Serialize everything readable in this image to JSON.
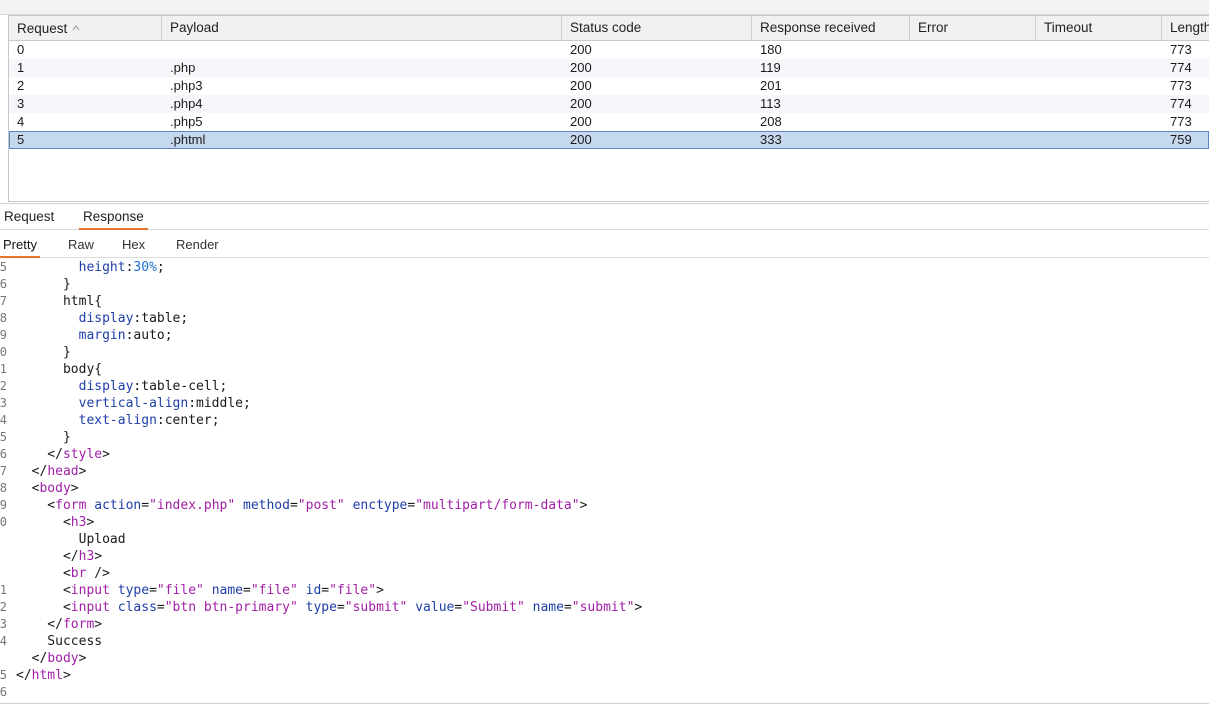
{
  "table": {
    "columns": [
      "Request",
      "Payload",
      "Status code",
      "Response received",
      "Error",
      "Timeout",
      "Length"
    ],
    "sorted_column": "Request",
    "rows": [
      {
        "request": "0",
        "payload": "",
        "status": "200",
        "received": "180",
        "error": "",
        "timeout": "",
        "length": "773"
      },
      {
        "request": "1",
        "payload": ".php",
        "status": "200",
        "received": "119",
        "error": "",
        "timeout": "",
        "length": "774"
      },
      {
        "request": "2",
        "payload": ".php3",
        "status": "200",
        "received": "201",
        "error": "",
        "timeout": "",
        "length": "773"
      },
      {
        "request": "3",
        "payload": ".php4",
        "status": "200",
        "received": "113",
        "error": "",
        "timeout": "",
        "length": "774"
      },
      {
        "request": "4",
        "payload": ".php5",
        "status": "200",
        "received": "208",
        "error": "",
        "timeout": "",
        "length": "773"
      },
      {
        "request": "5",
        "payload": ".phtml",
        "status": "200",
        "received": "333",
        "error": "",
        "timeout": "",
        "length": "759"
      }
    ],
    "selected_row": 5
  },
  "message_tabs": {
    "request": "Request",
    "response": "Response",
    "active": "Response"
  },
  "view_tabs": {
    "pretty": "Pretty",
    "raw": "Raw",
    "hex": "Hex",
    "render": "Render",
    "active": "Pretty"
  },
  "editor": {
    "lines": [
      {
        "n": "5",
        "text": "        height:30%;"
      },
      {
        "n": "6",
        "text": "      }"
      },
      {
        "n": "7",
        "text": "      html{"
      },
      {
        "n": "8",
        "text": "        display:table;"
      },
      {
        "n": "9",
        "text": "        margin:auto;"
      },
      {
        "n": "0",
        "text": "      }"
      },
      {
        "n": "1",
        "text": "      body{"
      },
      {
        "n": "2",
        "text": "        display:table-cell;"
      },
      {
        "n": "3",
        "text": "        vertical-align:middle;"
      },
      {
        "n": "4",
        "text": "        text-align:center;"
      },
      {
        "n": "5",
        "text": "      }"
      },
      {
        "n": "6",
        "text": "    </style>"
      },
      {
        "n": "7",
        "text": "  </head>"
      },
      {
        "n": "8",
        "text": "  <body>"
      },
      {
        "n": "9",
        "text": "    <form action=\"index.php\" method=\"post\" enctype=\"multipart/form-data\">"
      },
      {
        "n": "0",
        "text": "      <h3>"
      },
      {
        "n": "",
        "text": "        Upload"
      },
      {
        "n": "",
        "text": "      </h3>"
      },
      {
        "n": "",
        "text": "      <br />"
      },
      {
        "n": "1",
        "text": "      <input type=\"file\" name=\"file\" id=\"file\">"
      },
      {
        "n": "2",
        "text": "      <input class=\"btn btn-primary\" type=\"submit\" value=\"Submit\" name=\"submit\">"
      },
      {
        "n": "3",
        "text": "    </form>"
      },
      {
        "n": "4",
        "text": "    Success"
      },
      {
        "n": "",
        "text": "  </body>"
      },
      {
        "n": "5",
        "text": "</html>"
      },
      {
        "n": "6",
        "text": ""
      }
    ]
  },
  "colors": {
    "accent": "#e8712d",
    "selection": "#c6d8ee",
    "tag": "#a21fa7",
    "attr": "#1e3ea8",
    "number": "#1e6fd0"
  }
}
